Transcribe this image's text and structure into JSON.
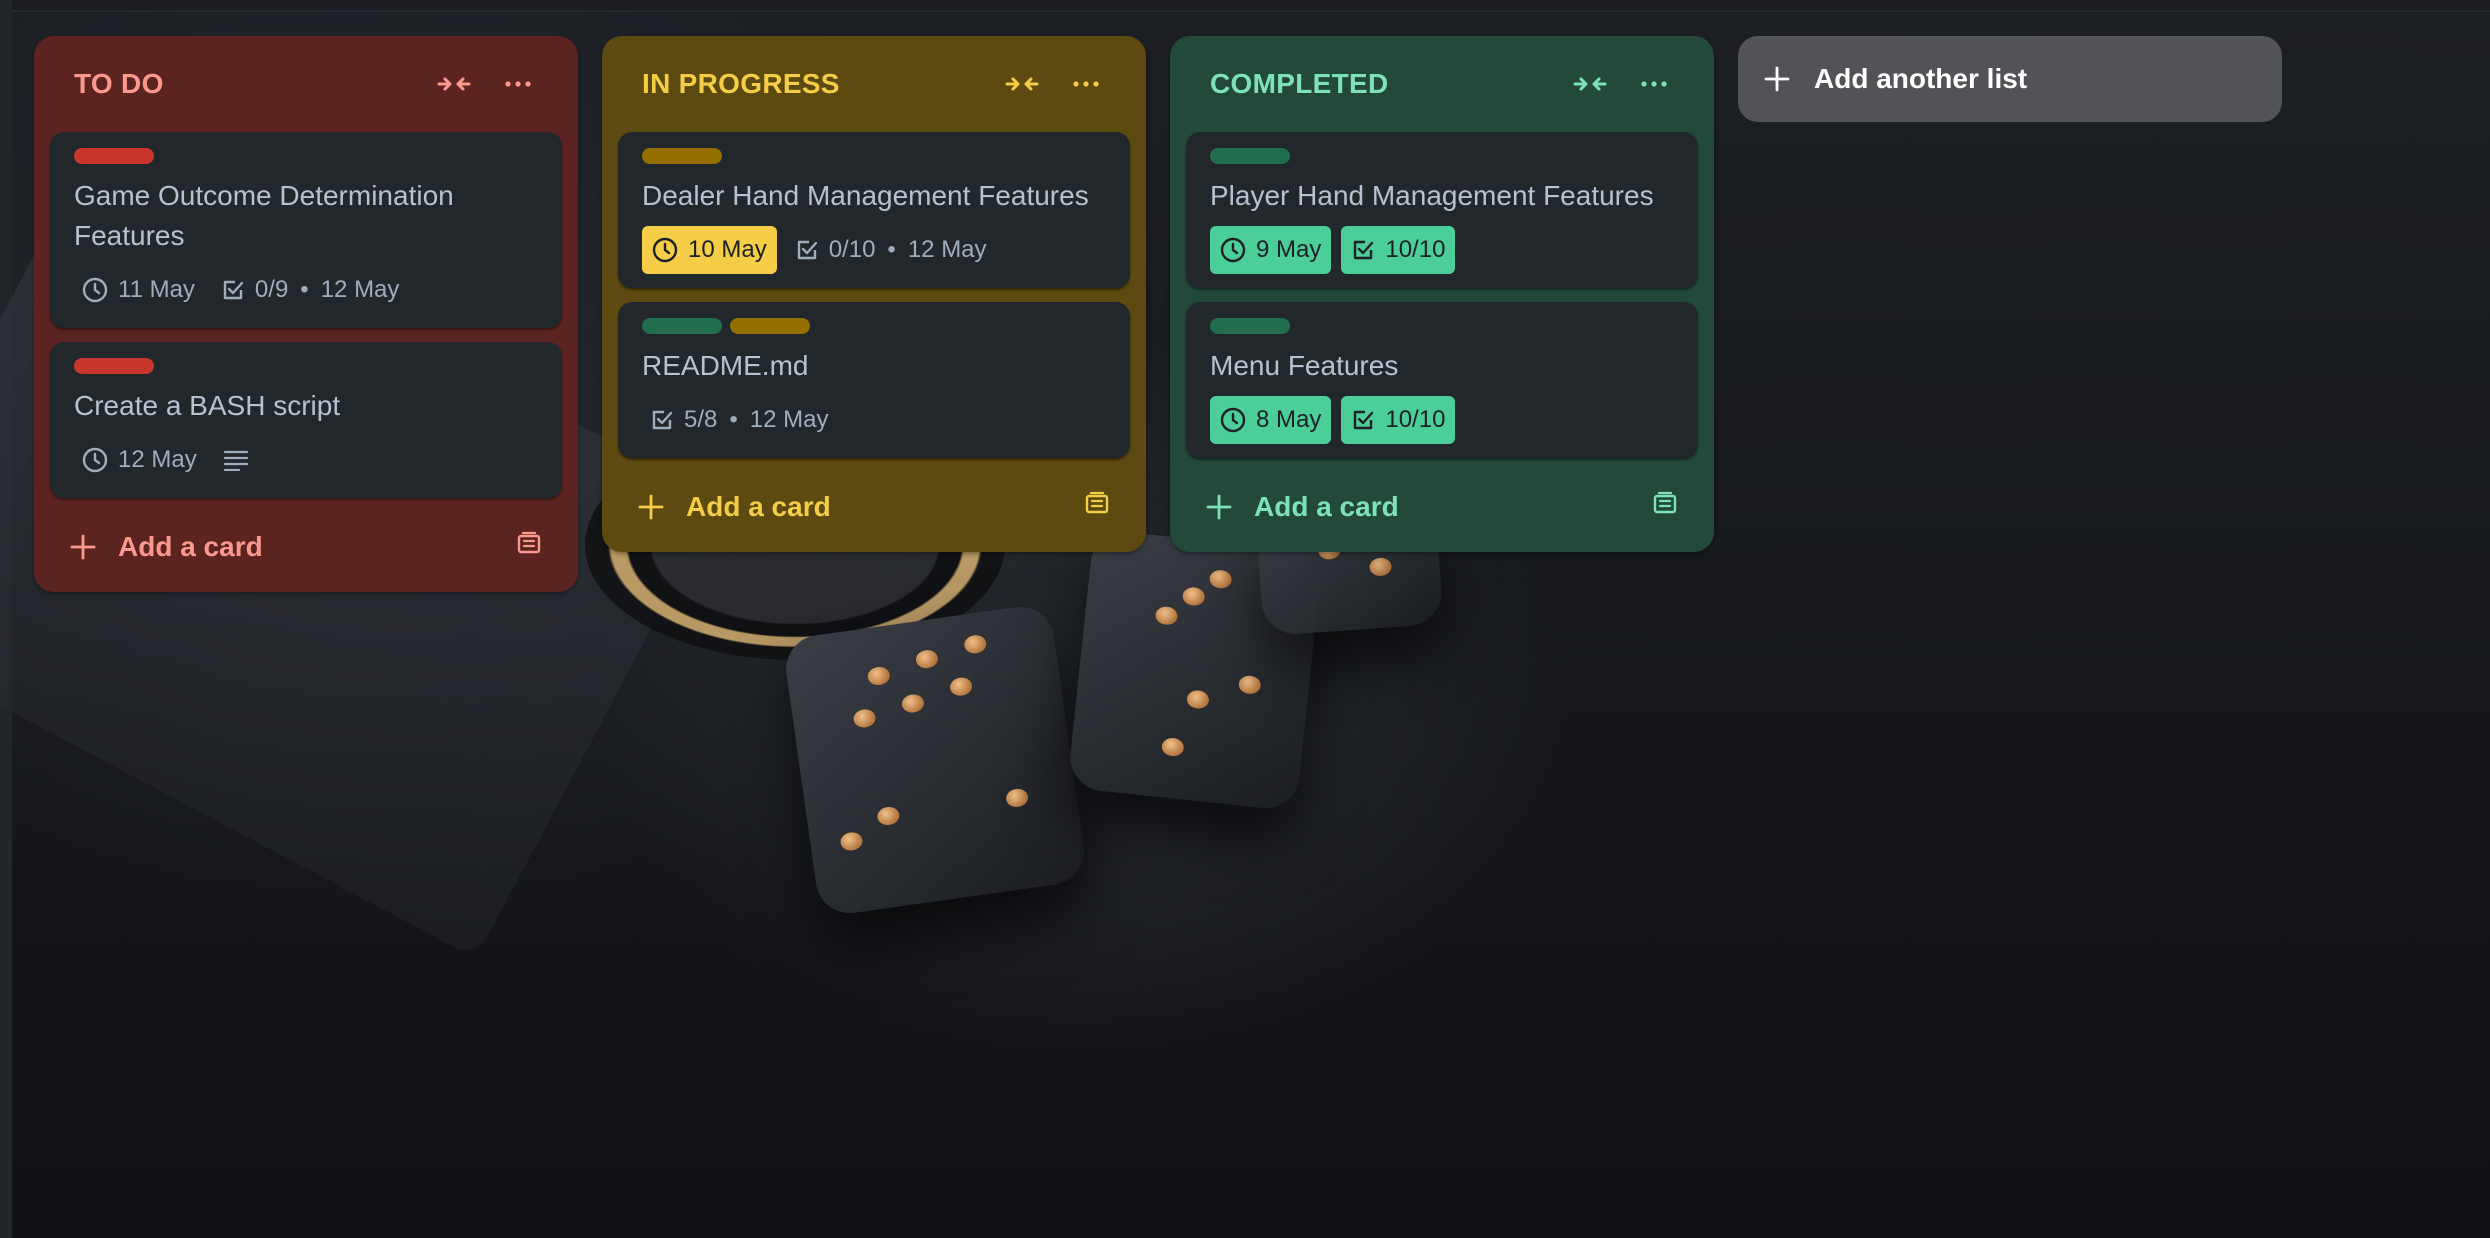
{
  "colors": {
    "todo_list": "#5c2420",
    "progress_list": "#5c4a10",
    "done_list": "#22493a",
    "label_red": "#c9372c",
    "label_yellow": "#946f00",
    "label_green": "#216e4e",
    "due_yellow": "#f5cd47",
    "due_green": "#4bce97"
  },
  "lists": [
    {
      "title": "TO DO",
      "add_card": "Add a card",
      "cards": [
        {
          "labels": [
            "red"
          ],
          "title": "Game Outcome Determination Features",
          "due": "11 May",
          "checklist": "0/9",
          "checklist_date": "12 May"
        },
        {
          "labels": [
            "red"
          ],
          "title": "Create a BASH script",
          "due": "12 May",
          "has_description": true
        }
      ]
    },
    {
      "title": "IN PROGRESS",
      "add_card": "Add a card",
      "cards": [
        {
          "labels": [
            "yellow"
          ],
          "title": "Dealer Hand Management Features",
          "due": "10 May",
          "checklist": "0/10",
          "checklist_date": "12 May"
        },
        {
          "labels": [
            "green",
            "yellow"
          ],
          "title": "README.md",
          "checklist": "5/8",
          "checklist_date": "12 May"
        }
      ]
    },
    {
      "title": "COMPLETED",
      "add_card": "Add a card",
      "cards": [
        {
          "labels": [
            "green"
          ],
          "title": "Player Hand Management Features",
          "due": "9 May",
          "checklist": "10/10"
        },
        {
          "labels": [
            "green"
          ],
          "title": "Menu Features",
          "due": "8 May",
          "checklist": "10/10"
        }
      ]
    }
  ],
  "add_list": "Add another list",
  "separator": "•",
  "icons": [
    "collapse-icon",
    "more-icon",
    "clock-icon",
    "checklist-icon",
    "description-icon",
    "plus-icon",
    "template-icon"
  ]
}
